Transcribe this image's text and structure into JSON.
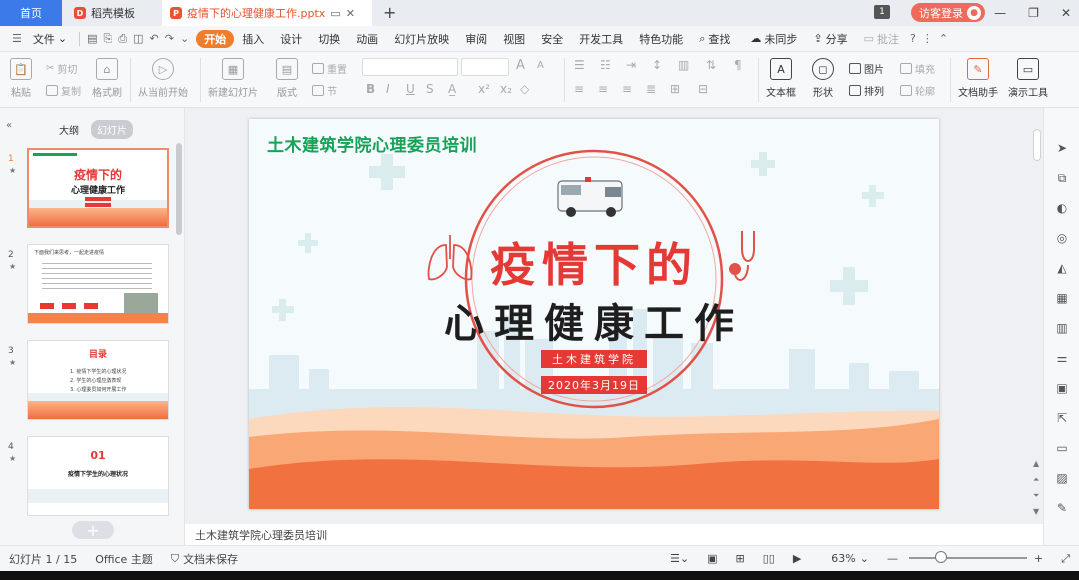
{
  "tabbar": {
    "home": "首页",
    "tabs": [
      {
        "label": "稻壳模板",
        "logo": "D"
      },
      {
        "label": "疫情下的心理健康工作.pptx",
        "logo": "P"
      }
    ],
    "badge": "1",
    "visitor_login": "访客登录"
  },
  "menu": {
    "file": "文件",
    "items": [
      "开始",
      "插入",
      "设计",
      "切换",
      "动画",
      "幻灯片放映",
      "审阅",
      "视图",
      "安全",
      "开发工具",
      "特色功能"
    ],
    "search": "查找",
    "sync": "未同步",
    "share": "分享",
    "comment": "批注"
  },
  "ribbon": {
    "paste": "粘贴",
    "cut": "剪切",
    "copy": "复制",
    "format_painter": "格式刷",
    "from_current": "从当前开始",
    "new_slide": "新建幻灯片",
    "layout": "版式",
    "reset": "重置",
    "section": "节",
    "font_a_big": "A",
    "font_a_small": "A",
    "bold": "B",
    "italic": "I",
    "underline": "U",
    "strike": "S",
    "textbox": "文本框",
    "shape": "形状",
    "picture": "图片",
    "fill": "填充",
    "arrange": "排列",
    "outline": "轮廓",
    "doc_assistant": "文档助手",
    "present_tools": "演示工具"
  },
  "leftpane": {
    "outline_tab": "大纲",
    "slides_tab": "幻灯片",
    "thumbs": [
      {
        "num": "1",
        "title": "疫情下的",
        "subtitle": "心理健康工作"
      },
      {
        "num": "2",
        "title": "下面我们来思考，一起走进疫情"
      },
      {
        "num": "3",
        "title": "目录",
        "lines": [
          "1. 疫情下学生的心理状况",
          "2. 学生的心理应激表现",
          "3. 心理委员如何开展工作"
        ]
      },
      {
        "num": "4",
        "title": "01",
        "subtitle": "疫情下学生的心理状况"
      }
    ]
  },
  "slide": {
    "header": "土木建筑学院心理委员培训",
    "title_line1": "疫情下的",
    "title_line2": "心理健康工作",
    "dept": "土木建筑学院",
    "date": "2020年3月19日"
  },
  "notes": "土木建筑学院心理委员培训",
  "status": {
    "slide_count": "幻灯片 1 / 15",
    "theme": "Office 主题",
    "save_state": "文档未保存",
    "zoom": "63%"
  },
  "colors": {
    "accent_orange": "#f07d2a",
    "title_red": "#e53935",
    "header_green": "#17a257",
    "tab_blue": "#3b7be9"
  }
}
